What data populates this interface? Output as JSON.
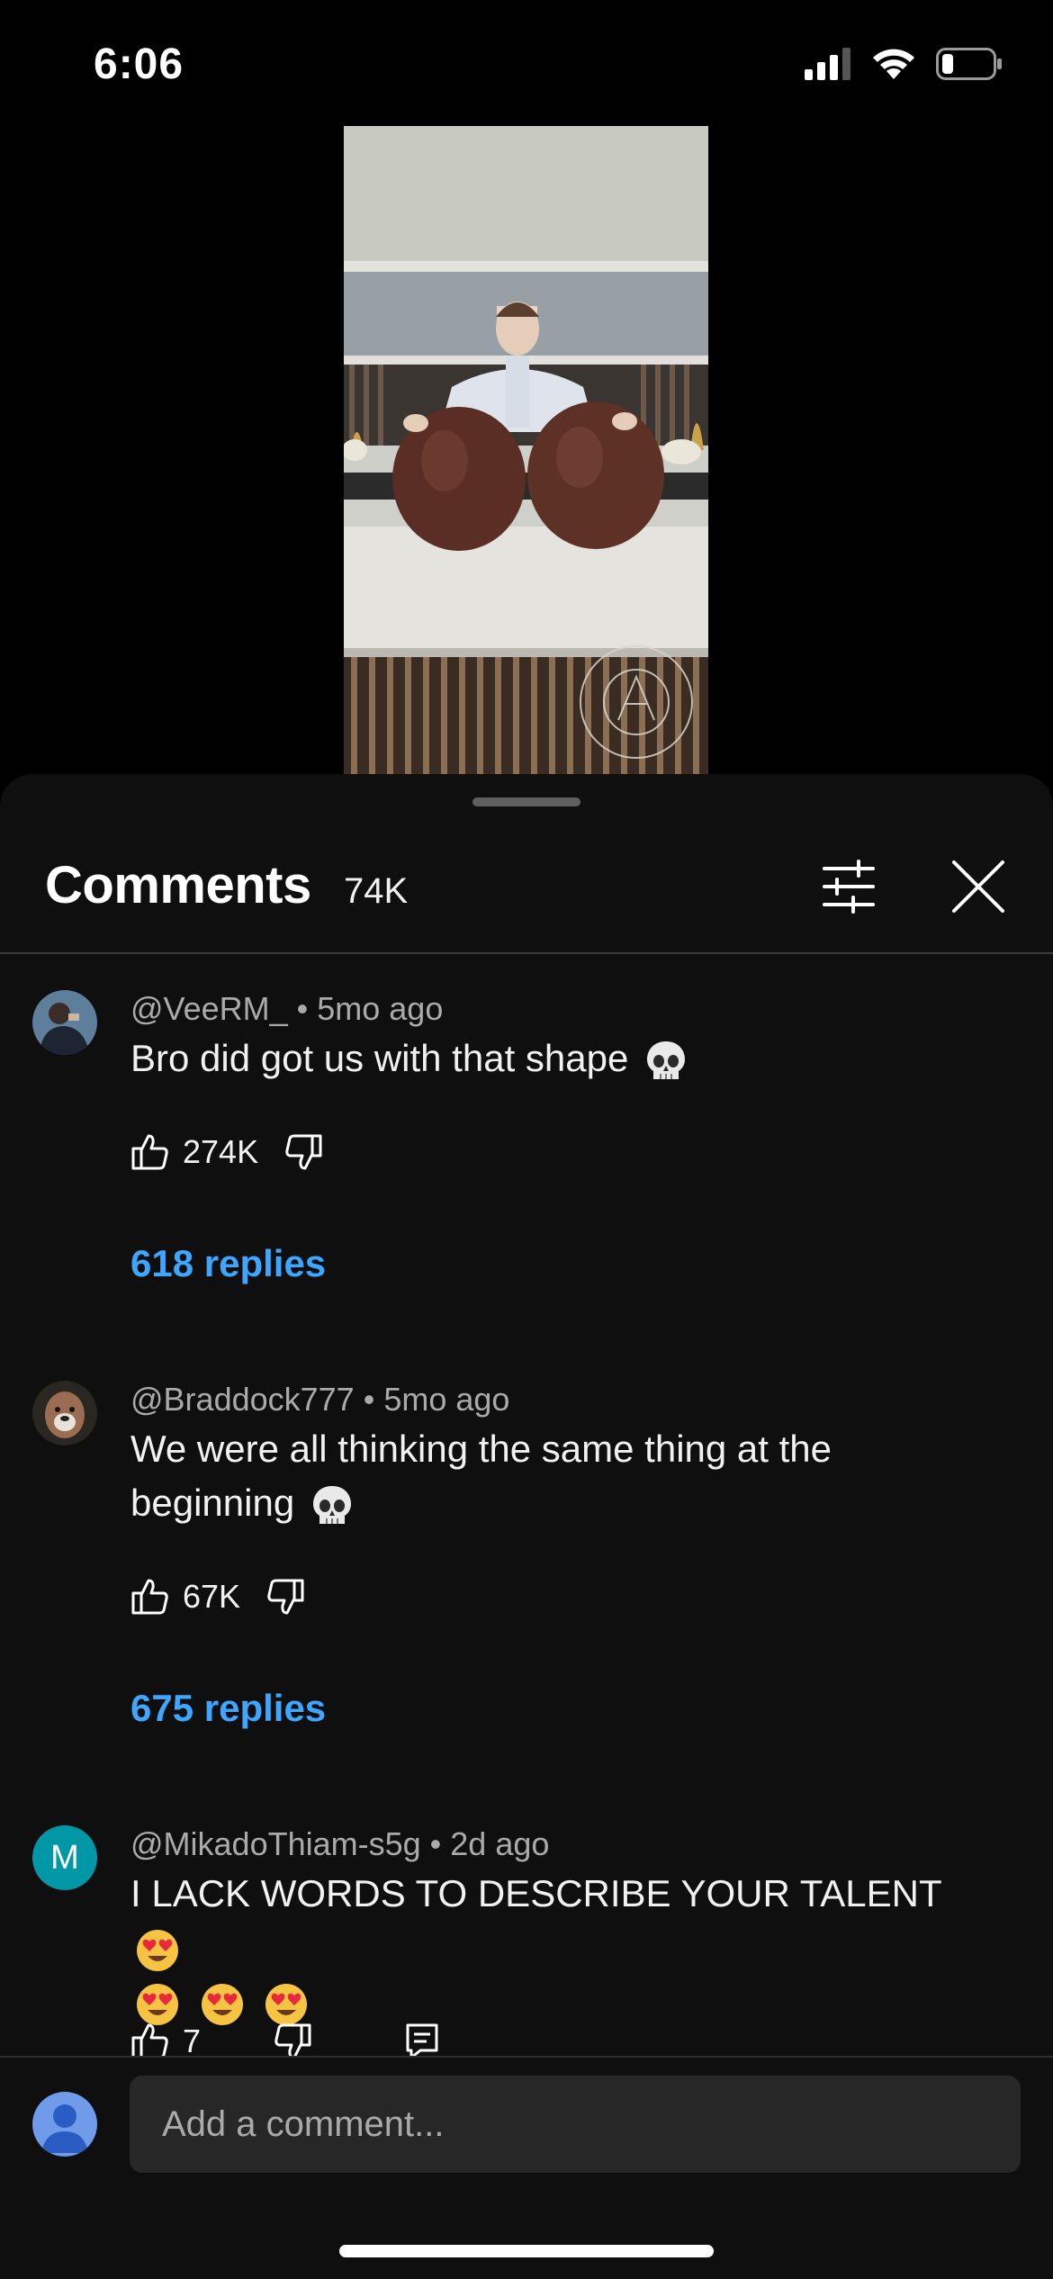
{
  "status_bar": {
    "time": "6:06",
    "icons": [
      "signal-icon",
      "wifi-icon",
      "battery-icon"
    ]
  },
  "video": {
    "watermark": "AMAURY GUICHON"
  },
  "comments_panel": {
    "title": "Comments",
    "count": "74K",
    "icons": [
      "filter-icon",
      "close-icon"
    ]
  },
  "comments": [
    {
      "author": "@VeeRM_",
      "age": "5mo ago",
      "text": "Bro did got us with that shape",
      "emoji": [
        "skull"
      ],
      "likes": "274K",
      "replies": "618 replies"
    },
    {
      "author": "@Braddock777",
      "age": "5mo ago",
      "text_line1": "We were all thinking the same thing at the",
      "text_line2": "beginning",
      "emoji": [
        "skull"
      ],
      "likes": "67K",
      "replies": "675 replies"
    },
    {
      "author": "@MikadoThiam-s5g",
      "age": "2d ago",
      "avatar_letter": "M",
      "text": "I LACK WORDS TO DESCRIBE YOUR TALENT",
      "emoji": [
        "heart-eyes",
        "heart-eyes",
        "heart-eyes",
        "heart-eyes"
      ],
      "likes": "7"
    }
  ],
  "composer": {
    "placeholder": "Add a comment..."
  },
  "colors": {
    "sheet_bg": "#0f0f0f",
    "link": "#3ea6ff",
    "meta": "#aaaaaa",
    "avatar_m": "#0097a7"
  }
}
